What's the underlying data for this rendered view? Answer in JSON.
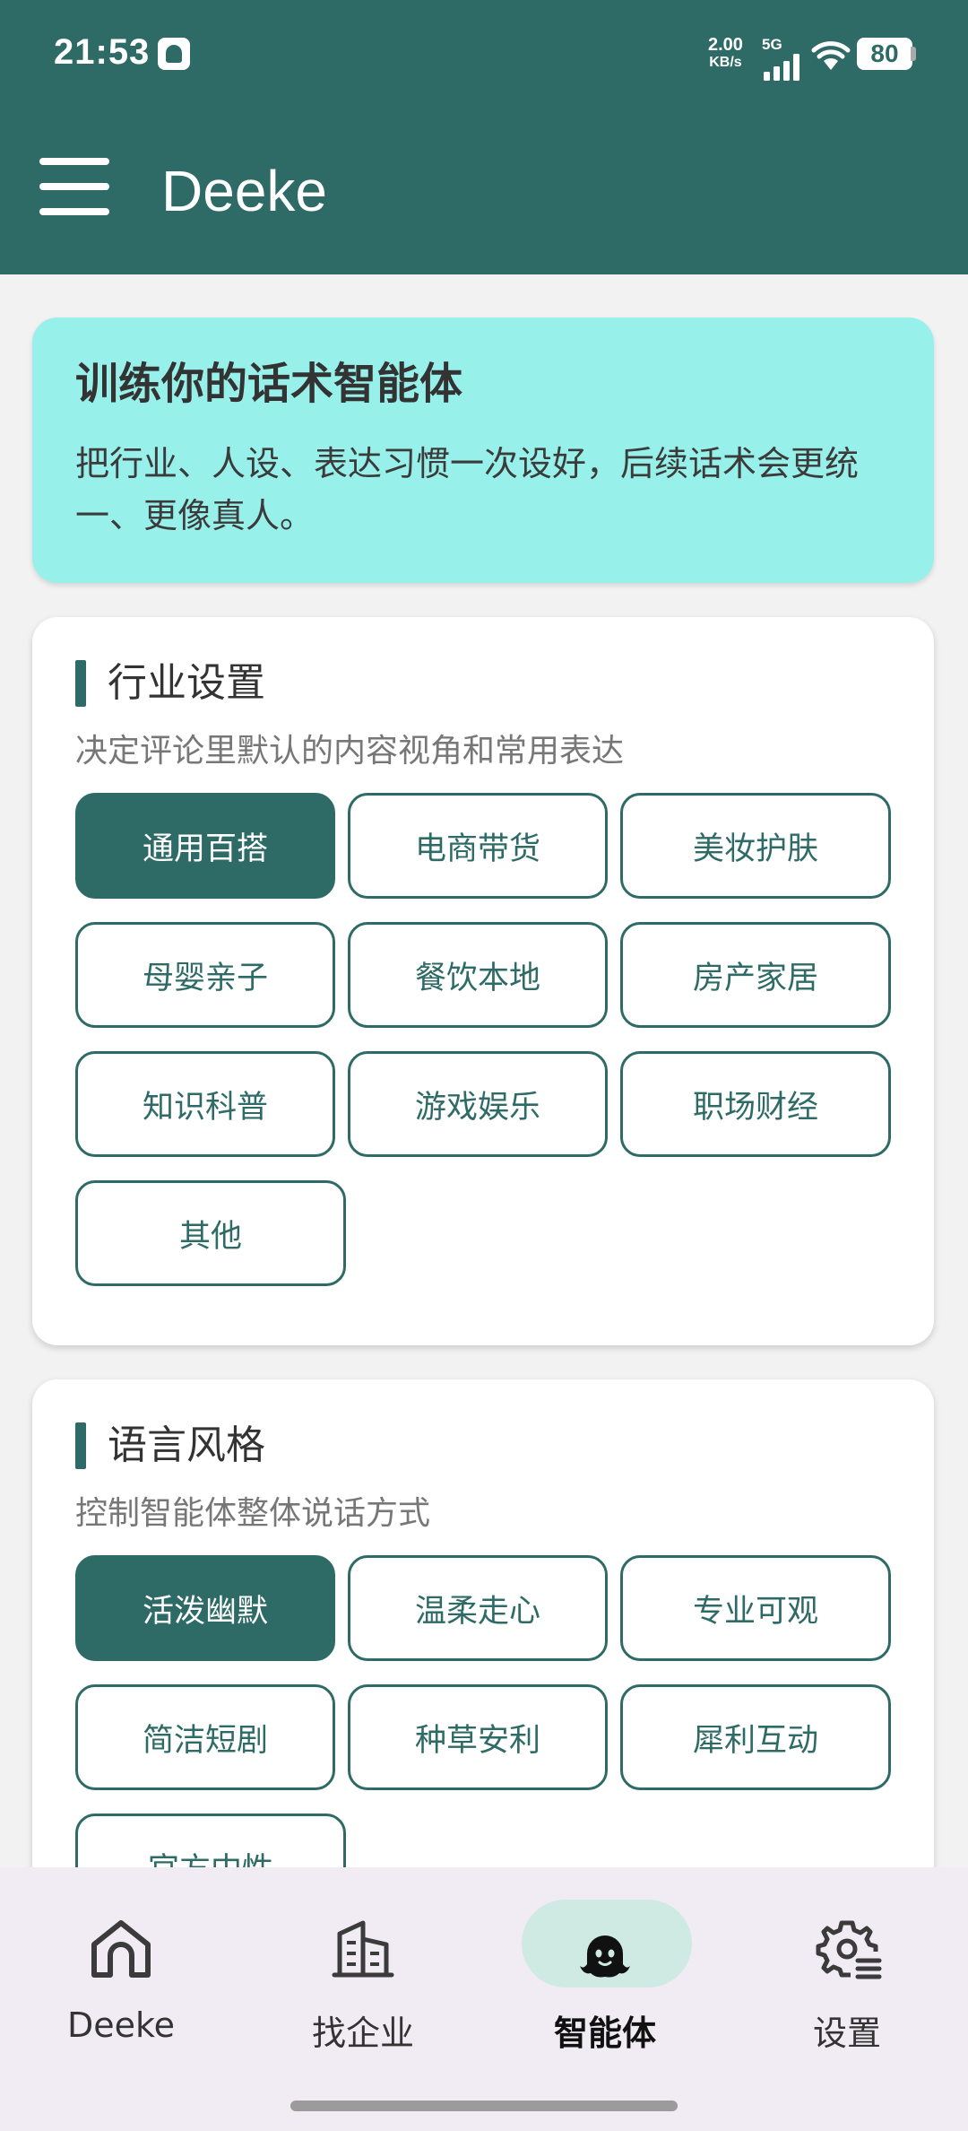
{
  "status_bar": {
    "time": "21:53",
    "net_speed_value": "2.00",
    "net_speed_unit": "KB/s",
    "network_type": "5G",
    "battery": "80"
  },
  "app_bar": {
    "title": "Deeke",
    "menu_icon": "menu-icon"
  },
  "hero": {
    "title": "训练你的话术智能体",
    "description": "把行业、人设、表达习惯一次设好，后续话术会更统一、更像真人。"
  },
  "industry": {
    "title": "行业设置",
    "subtitle": "决定评论里默认的内容视角和常用表达",
    "options": [
      "通用百搭",
      "电商带货",
      "美妆护肤",
      "母婴亲子",
      "餐饮本地",
      "房产家居",
      "知识科普",
      "游戏娱乐",
      "职场财经",
      "其他"
    ],
    "selected": "通用百搭"
  },
  "style": {
    "title": "语言风格",
    "subtitle": "控制智能体整体说话方式",
    "options": [
      "活泼幽默",
      "温柔走心",
      "专业可观",
      "简洁短剧",
      "种草安利",
      "犀利互动",
      "官方中性"
    ],
    "selected": "活泼幽默"
  },
  "colors": {
    "primary": "#2f6b66",
    "hero_bg": "#98f0ea",
    "nav_bg": "#f1ebf4",
    "nav_active_pill": "#cfe9e3"
  },
  "bottom_nav": {
    "items": [
      {
        "label": "Deeke",
        "icon": "home-icon"
      },
      {
        "label": "找企业",
        "icon": "building-icon"
      },
      {
        "label": "智能体",
        "icon": "ghost-icon"
      },
      {
        "label": "设置",
        "icon": "settings-icon"
      }
    ],
    "active": "智能体"
  }
}
